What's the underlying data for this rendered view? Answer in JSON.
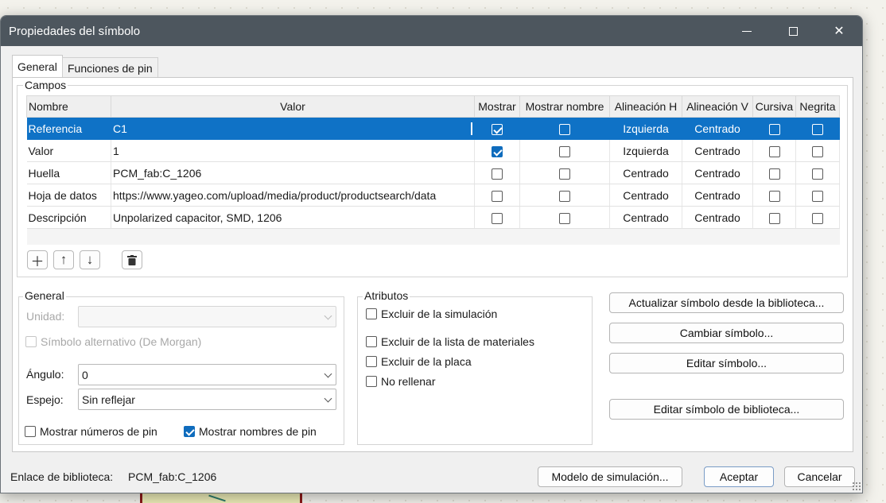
{
  "dialog": {
    "title": "Propiedades del símbolo",
    "tabs": [
      "General",
      "Funciones de pin"
    ]
  },
  "fields": {
    "group_label": "Campos",
    "headers": [
      "Nombre",
      "Valor",
      "Mostrar",
      "Mostrar nombre",
      "Alineación H",
      "Alineación V",
      "Cursiva",
      "Negrita"
    ],
    "rows": [
      {
        "name": "Referencia",
        "value": "C1",
        "show": true,
        "show_name": false,
        "h_align": "Izquierda",
        "v_align": "Centrado",
        "italic": false,
        "bold": false,
        "selected": true
      },
      {
        "name": "Valor",
        "value": "1",
        "show": true,
        "show_name": false,
        "h_align": "Izquierda",
        "v_align": "Centrado",
        "italic": false,
        "bold": false
      },
      {
        "name": "Huella",
        "value": "PCM_fab:C_1206",
        "show": false,
        "show_name": false,
        "h_align": "Centrado",
        "v_align": "Centrado",
        "italic": false,
        "bold": false
      },
      {
        "name": "Hoja de datos",
        "value": "https://www.yageo.com/upload/media/product/productsearch/data",
        "show": false,
        "show_name": false,
        "h_align": "Centrado",
        "v_align": "Centrado",
        "italic": false,
        "bold": false
      },
      {
        "name": "Descripción",
        "value": "Unpolarized capacitor, SMD, 1206",
        "show": false,
        "show_name": false,
        "h_align": "Centrado",
        "v_align": "Centrado",
        "italic": false,
        "bold": false
      }
    ],
    "toolbar_icons": [
      "add-icon",
      "move-up-icon",
      "move-down-icon",
      "delete-icon"
    ]
  },
  "general": {
    "group_label": "General",
    "unit_label": "Unidad:",
    "unit_value": "",
    "demorgan_label": "Símbolo alternativo (De Morgan)",
    "angle_label": "Ángulo:",
    "angle_value": "0",
    "mirror_label": "Espejo:",
    "mirror_value": "Sin reflejar",
    "show_pin_numbers_label": "Mostrar números de pin",
    "show_pin_numbers": false,
    "show_pin_names_label": "Mostrar nombres de pin",
    "show_pin_names": true
  },
  "attributes": {
    "group_label": "Atributos",
    "items": [
      {
        "label": "Excluir de la simulación",
        "checked": false
      },
      {
        "label": "Excluir de la lista de materiales",
        "checked": false
      },
      {
        "label": "Excluir de la placa",
        "checked": false
      },
      {
        "label": "No rellenar",
        "checked": false
      }
    ]
  },
  "actions": {
    "update_from_library": "Actualizar símbolo desde la biblioteca...",
    "change_symbol": "Cambiar símbolo...",
    "edit_symbol": "Editar símbolo...",
    "edit_library_symbol": "Editar símbolo de biblioteca..."
  },
  "footer": {
    "library_link_label": "Enlace de biblioteca:",
    "library_link_value": "PCM_fab:C_1206",
    "sim_model": "Modelo de simulación...",
    "ok": "Aceptar",
    "cancel": "Cancelar"
  },
  "colors": {
    "selection": "#0f72c6",
    "titlebar": "#4d565e",
    "checkbox_on": "#0f6cbd"
  }
}
